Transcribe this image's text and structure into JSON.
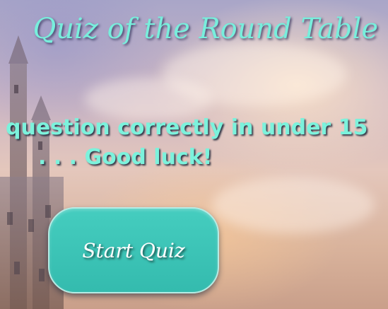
{
  "title": "Quiz of the Round Table",
  "message": {
    "line1": "question correctly in under 15",
    "line2": ". . . Good luck!"
  },
  "start_button": {
    "label": "Start Quiz"
  },
  "colors": {
    "accent_text": "#7cf2dc",
    "button_fill": "#3dc4b6",
    "button_text": "#ffffff"
  },
  "background": {
    "scene": "castle-sky-painting"
  }
}
